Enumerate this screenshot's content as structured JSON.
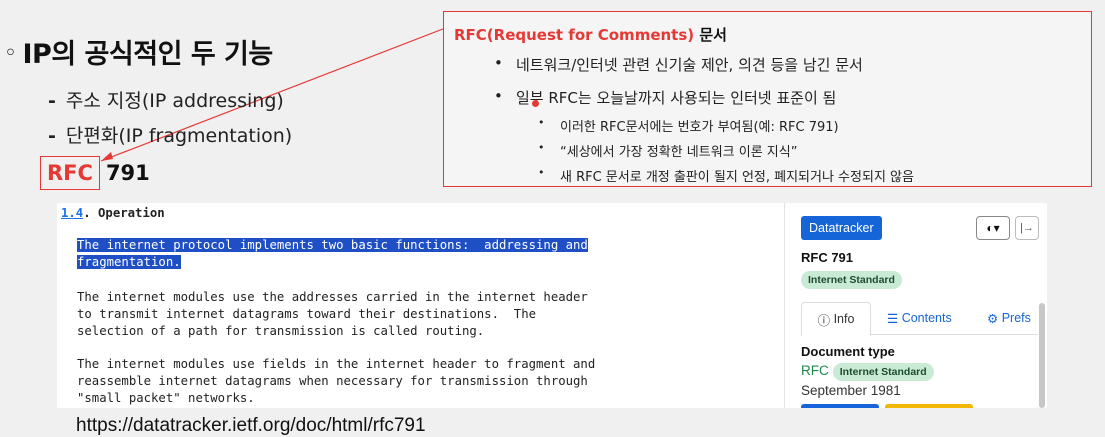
{
  "slide": {
    "bullet": "◦",
    "heading": "IP의 공식적인 두 기능",
    "items": [
      {
        "dash": "-",
        "text": "주소 지정(IP addressing)"
      },
      {
        "dash": "-",
        "text": "단편화(IP fragmentation)"
      }
    ],
    "rfc_label": "RFC",
    "rfc_number": "791",
    "url": "https://datatracker.ietf.org/doc/html/rfc791"
  },
  "callout": {
    "title_red": "RFC(Request for Comments)",
    "title_rest": "문서",
    "bullets": [
      "네트워크/인터넷 관련 신기술 제안, 의견 등을 남긴 문서",
      "일부 RFC는 오늘날까지 사용되는 인터넷 표준이 됨"
    ],
    "subbullets": [
      "이러한 RFC문서에는 번호가 부여됨(예: RFC 791)",
      "“세상에서 가장 정확한 네트워크 이론 지식”",
      "새 RFC 문서로 개정 출판이 될지 언정, 폐지되거나 수정되지 않음"
    ],
    "accent": "#e53935"
  },
  "doc": {
    "section_num": "1.4",
    "section_title": ".  Operation",
    "hl_line1": "The internet protocol implements two basic functions:  addressing and",
    "hl_line2": "fragmentation.",
    "para1": "The internet modules use the addresses carried in the internet header\nto transmit internet datagrams toward their destinations.  The\nselection of a path for transmission is called routing.",
    "para2": "The internet modules use fields in the internet header to fragment and\nreassemble internet datagrams when necessary for transmission through\n\"small packet\" networks."
  },
  "sidebar": {
    "datatracker_label": "Datatracker",
    "theme_icon": "◐▾",
    "expand_icon": "|→",
    "rfc_title": "RFC 791",
    "status_badge": "Internet Standard",
    "tabs": {
      "info": "Info",
      "contents": "Contents",
      "prefs": "Prefs"
    },
    "doc_type_label": "Document type",
    "doc_type_rfc": "RFC",
    "doc_type_badge": "Internet Standard",
    "date": "September 1981"
  }
}
